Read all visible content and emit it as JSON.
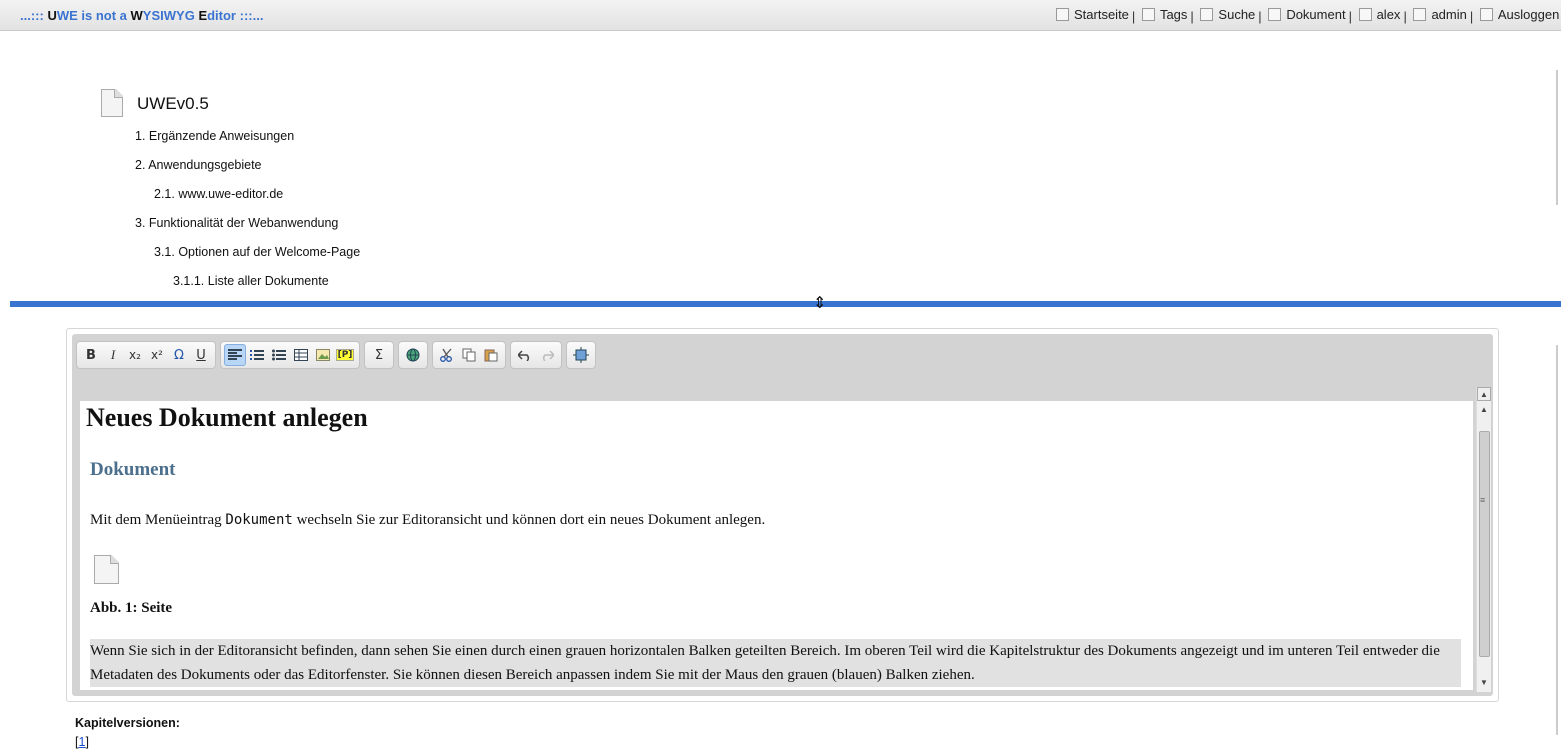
{
  "topbar": {
    "brand": {
      "pre": "...:::",
      "u": "U",
      "we": "WE is not a ",
      "w": "W",
      "ysiwyg": "YSIWYG",
      "e": "E",
      "ditor": "ditor",
      "post": ":::..."
    },
    "nav": {
      "home": "Startseite",
      "tags": "Tags",
      "search": "Suche",
      "document": "Dokument",
      "user": "alex",
      "admin": "admin",
      "logout": "Ausloggen",
      "sep": "|"
    }
  },
  "toc": {
    "title": "UWEv0.5",
    "items": [
      {
        "label": "1. Ergänzende Anweisungen"
      },
      {
        "label": "2. Anwendungsgebiete"
      },
      {
        "label": "2.1. www.uwe-editor.de"
      },
      {
        "label": "3. Funktionalität der Webanwendung"
      },
      {
        "label": "3.1. Optionen auf der Welcome-Page"
      },
      {
        "label": "3.1.1. Liste aller Dokumente"
      }
    ]
  },
  "toolbar": {
    "bold": "B",
    "italic": "I",
    "subscript": "x₂",
    "superscript": "x²",
    "special_char": "Ω",
    "underline": "U",
    "paragraph": "[P]",
    "formula": "Σ"
  },
  "content": {
    "heading": "Neues Dokument anlegen",
    "subheading": "Dokument",
    "para1_before": "Mit dem Menüeintrag ",
    "para1_code": "Dokument",
    "para1_after": " wechseln Sie zur Editoransicht und können dort ein neues Dokument anlegen.",
    "caption": "Abb. 1: Seite",
    "para2": "Wenn Sie sich in der Editoransicht befinden, dann sehen Sie einen durch einen grauen horizontalen Balken geteilten Bereich. Im oberen Teil wird die Kapitelstruktur des Dokuments angezeigt und im unteren Teil entweder die Metadaten des Dokuments oder das Editorfenster. Sie können diesen Bereich anpassen indem Sie mit der Maus den grauen (blauen) Balken ziehen."
  },
  "versions": {
    "label": "Kapitelversionen:",
    "bracket_open": "[",
    "link": "1",
    "bracket_close": "]"
  },
  "colors": {
    "splitter": "#3874d0",
    "brand": "#3a73d0",
    "subheading": "#4b6f8c",
    "highlight": "#e1e1e1"
  }
}
